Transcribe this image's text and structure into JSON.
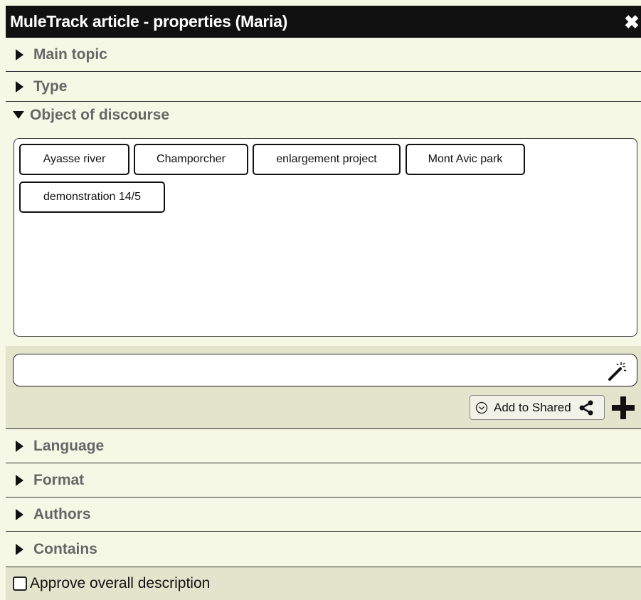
{
  "window": {
    "title": "MuleTrack article - properties (Maria)",
    "close_icon": "close-icon",
    "close_glyph": "✖"
  },
  "panels": {
    "main_topic": "Main topic",
    "type": "Type",
    "object_of_discourse": "Object of discourse",
    "language": "Language",
    "format": "Format",
    "authors": "Authors",
    "contains": "Contains"
  },
  "tags": [
    "Ayasse river",
    "Champorcher",
    "enlargement project",
    "Mont Avic park",
    "demonstration 14/5"
  ],
  "input": {
    "value": "",
    "placeholder": "",
    "wand_icon": "magic-wand-icon"
  },
  "actions": {
    "add_to_shared_label": "Add to Shared",
    "share_icon": "share-icon",
    "add_icon": "plus-icon"
  },
  "footer": {
    "approve_label": "Approve overall description",
    "approve_checked": false
  },
  "colors": {
    "titlebar_bg": "#111111",
    "panel_bg": "#f6f8e6",
    "zone_bg": "#e2e4cb",
    "header_text": "#666666"
  }
}
